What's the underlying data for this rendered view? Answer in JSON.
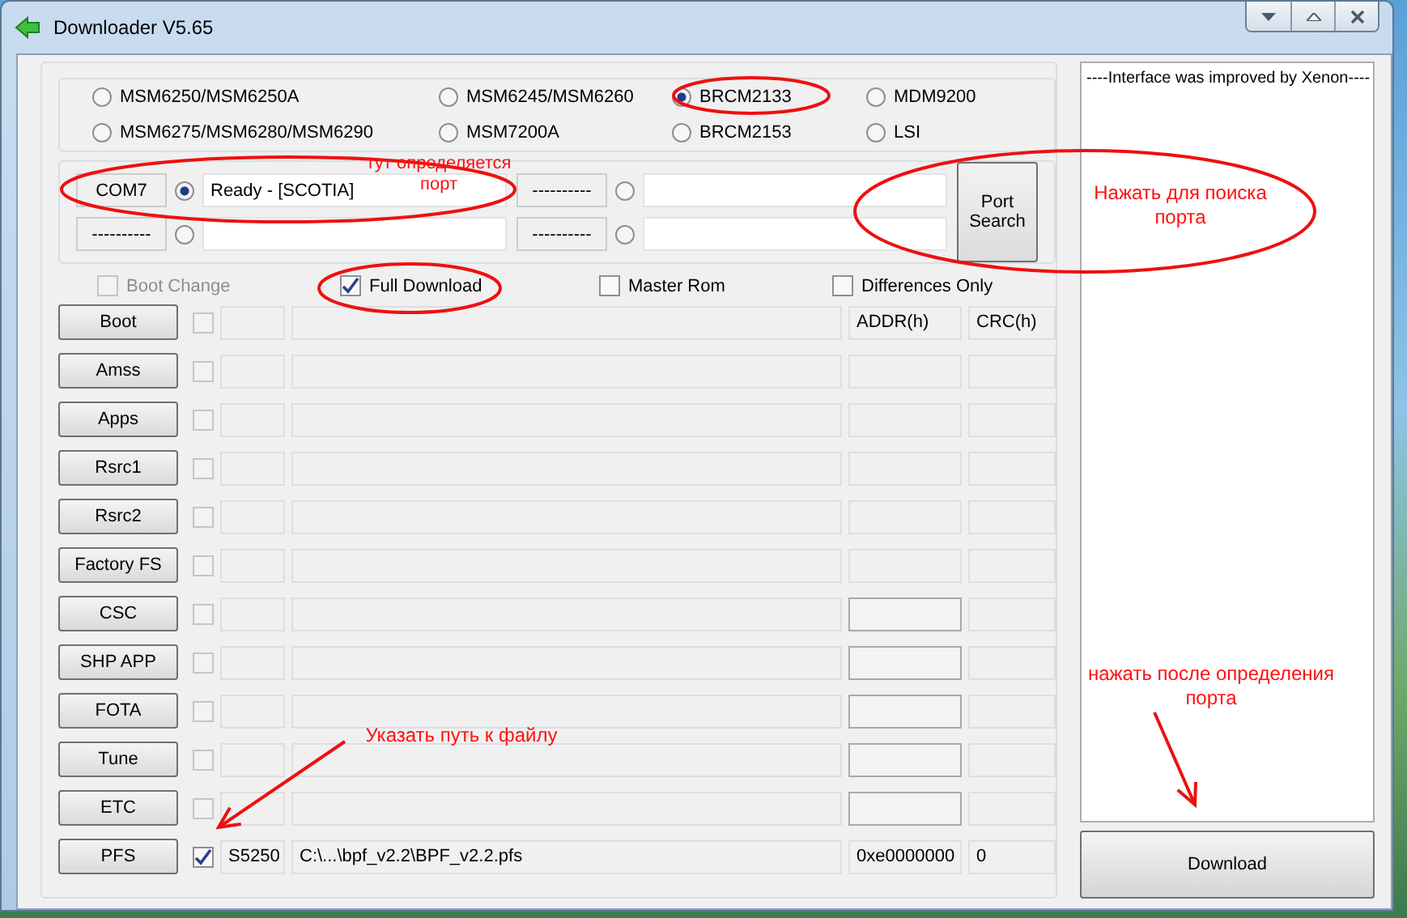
{
  "window": {
    "title": "Downloader V5.65"
  },
  "chipsets": [
    {
      "label": "MSM6250/MSM6250A",
      "selected": false
    },
    {
      "label": "MSM6245/MSM6260",
      "selected": false
    },
    {
      "label": "BRCM2133",
      "selected": true
    },
    {
      "label": "MDM9200",
      "selected": false
    },
    {
      "label": "MSM6275/MSM6280/MSM6290",
      "selected": false
    },
    {
      "label": "MSM7200A",
      "selected": false
    },
    {
      "label": "BRCM2153",
      "selected": false
    },
    {
      "label": "LSI",
      "selected": false
    }
  ],
  "ports": [
    {
      "label": "COM7",
      "status": "Ready - [SCOTIA]",
      "selected": true
    },
    {
      "label": "----------",
      "selected": false
    },
    {
      "label": "----------",
      "selected": false
    },
    {
      "label": "----------",
      "selected": false
    }
  ],
  "port_search": {
    "label": "Port Search"
  },
  "options": [
    {
      "label": "Boot Change",
      "checked": false,
      "disabled": true
    },
    {
      "label": "Full Download",
      "checked": true,
      "disabled": false
    },
    {
      "label": "Master Rom",
      "checked": false,
      "disabled": false
    },
    {
      "label": "Differences Only",
      "checked": false,
      "disabled": false
    }
  ],
  "rows": [
    {
      "label": "Boot",
      "checked": false,
      "addr": "ADDR(h)",
      "crc": "CRC(h)",
      "addr_enabled": false
    },
    {
      "label": "Amss",
      "checked": false,
      "addr_enabled": false
    },
    {
      "label": "Apps",
      "checked": false,
      "addr_enabled": false
    },
    {
      "label": "Rsrc1",
      "checked": false,
      "addr_enabled": false
    },
    {
      "label": "Rsrc2",
      "checked": false,
      "addr_enabled": false
    },
    {
      "label": "Factory FS",
      "checked": false,
      "addr_enabled": false
    },
    {
      "label": "CSC",
      "checked": false,
      "addr_enabled": true
    },
    {
      "label": "SHP APP",
      "checked": false,
      "addr_enabled": true
    },
    {
      "label": "FOTA",
      "checked": false,
      "addr_enabled": true
    },
    {
      "label": "Tune",
      "checked": false,
      "addr_enabled": true
    },
    {
      "label": "ETC",
      "checked": false,
      "addr_enabled": true
    },
    {
      "label": "PFS",
      "checked": true,
      "model": "S5250",
      "path": "C:\\...\\bpf_v2.2\\BPF_v2.2.pfs",
      "addr": "0xe0000000",
      "crc": "0",
      "addr_enabled": false
    }
  ],
  "log": {
    "text": "----Interface was improved by Xenon----"
  },
  "download": {
    "label": "Download"
  },
  "notes": [
    "тут определяется порт",
    "Нажать для поиска порта",
    "Указать путь к файлу",
    "нажать после определения порта"
  ]
}
